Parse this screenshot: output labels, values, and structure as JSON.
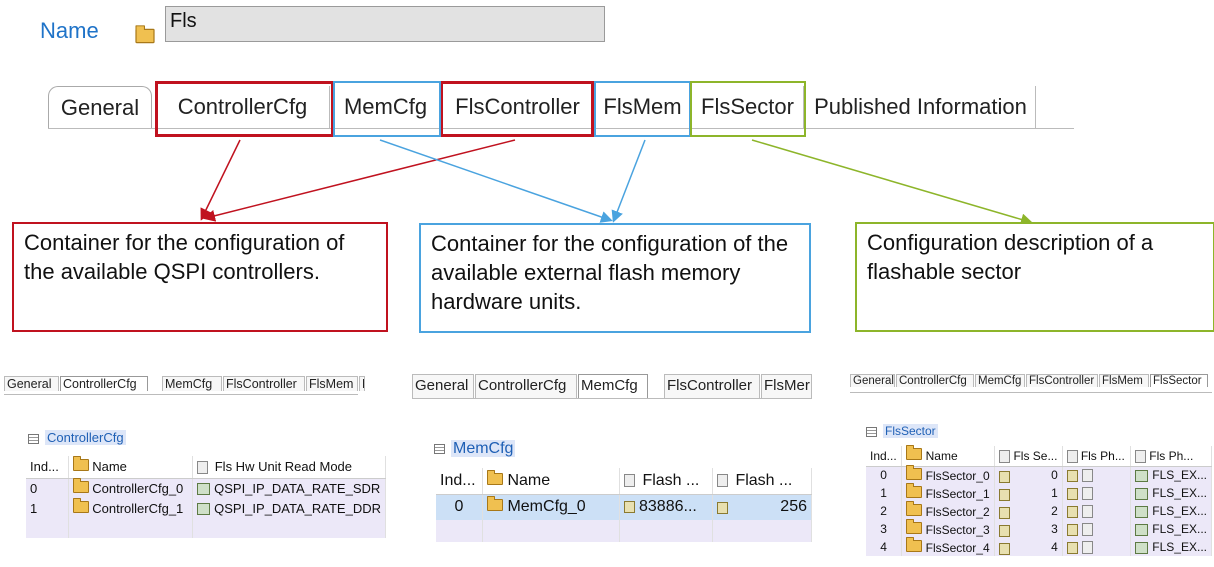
{
  "name_field": {
    "label": "Name",
    "value": "Fls"
  },
  "tabs": [
    {
      "label": "General"
    },
    {
      "label": "ControllerCfg"
    },
    {
      "label": "MemCfg"
    },
    {
      "label": "FlsController"
    },
    {
      "label": "FlsMem"
    },
    {
      "label": "FlsSector"
    },
    {
      "label": "Published Information"
    }
  ],
  "colors": {
    "red": "#c0121f",
    "blue": "#4aa3df",
    "green": "#8db52a",
    "title_blue": "#1f73c8"
  },
  "callouts": {
    "controller": "Container for the configuration of the available QSPI controllers.",
    "memory": "Container for the configuration of the available external flash memory hardware units.",
    "sector": "Configuration description of a flashable sector"
  },
  "panel_controller": {
    "tabs": [
      "General",
      "ControllerCfg",
      "MemCfg",
      "FlsController",
      "FlsMem",
      "FlsSe"
    ],
    "title": "ControllerCfg",
    "headers": [
      "Ind...",
      "Name",
      "Fls Hw Unit Read Mode"
    ],
    "rows": [
      {
        "index": "0",
        "name": "ControllerCfg_0",
        "mode": "QSPI_IP_DATA_RATE_SDR"
      },
      {
        "index": "1",
        "name": "ControllerCfg_1",
        "mode": "QSPI_IP_DATA_RATE_DDR"
      }
    ]
  },
  "panel_memory": {
    "tabs": [
      "General",
      "ControllerCfg",
      "MemCfg",
      "FlsController",
      "FlsMer"
    ],
    "title": "MemCfg",
    "headers": [
      "Ind...",
      "Name",
      "Flash ...",
      "Flash ..."
    ],
    "rows": [
      {
        "index": "0",
        "name": "MemCfg_0",
        "flash1": "83886...",
        "flash2": "256"
      }
    ]
  },
  "panel_sector": {
    "tabs": [
      "General",
      "ControllerCfg",
      "MemCfg",
      "FlsController",
      "FlsMem",
      "FlsSector"
    ],
    "title": "FlsSector",
    "headers": [
      "Ind...",
      "Name",
      "Fls Se...",
      "Fls Ph...",
      "Fls Ph..."
    ],
    "rows": [
      {
        "index": "0",
        "name": "FlsSector_0",
        "se": "0",
        "ph2": "FLS_EX..."
      },
      {
        "index": "1",
        "name": "FlsSector_1",
        "se": "1",
        "ph2": "FLS_EX..."
      },
      {
        "index": "2",
        "name": "FlsSector_2",
        "se": "2",
        "ph2": "FLS_EX..."
      },
      {
        "index": "3",
        "name": "FlsSector_3",
        "se": "3",
        "ph2": "FLS_EX..."
      },
      {
        "index": "4",
        "name": "FlsSector_4",
        "se": "4",
        "ph2": "FLS_EX..."
      }
    ]
  }
}
